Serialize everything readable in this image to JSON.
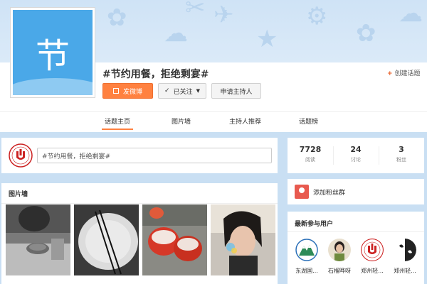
{
  "topic": {
    "avatar_char": "节",
    "title": "#节约用餐，拒绝剩宴#",
    "create_label": "创建话题"
  },
  "actions": {
    "post_label": "发微博",
    "follow_label": "已关注",
    "host_label": "申请主持人"
  },
  "tabs": [
    {
      "label": "话题主页",
      "active": true
    },
    {
      "label": "图片墙",
      "active": false
    },
    {
      "label": "主持人推荐",
      "active": false
    },
    {
      "label": "话题榜",
      "active": false
    }
  ],
  "composer": {
    "value": "#节约用餐，拒绝剩宴#"
  },
  "picture_wall": {
    "title": "图片墙"
  },
  "stats": [
    {
      "value": "7728",
      "label": "阅读"
    },
    {
      "value": "24",
      "label": "讨论"
    },
    {
      "value": "3",
      "label": "粉丝"
    }
  ],
  "fans_group": {
    "label": "添加粉丝群"
  },
  "recent_users": {
    "title": "最新参与用户",
    "users": [
      {
        "name": "东湖国..."
      },
      {
        "name": "石榴晔呀"
      },
      {
        "name": "郑州轻..."
      },
      {
        "name": "郑州轻..."
      }
    ]
  },
  "colors": {
    "accent": "#ff8140",
    "avatar_bg": "#4aa8e8",
    "banner_bg": "#cfe3f6"
  }
}
